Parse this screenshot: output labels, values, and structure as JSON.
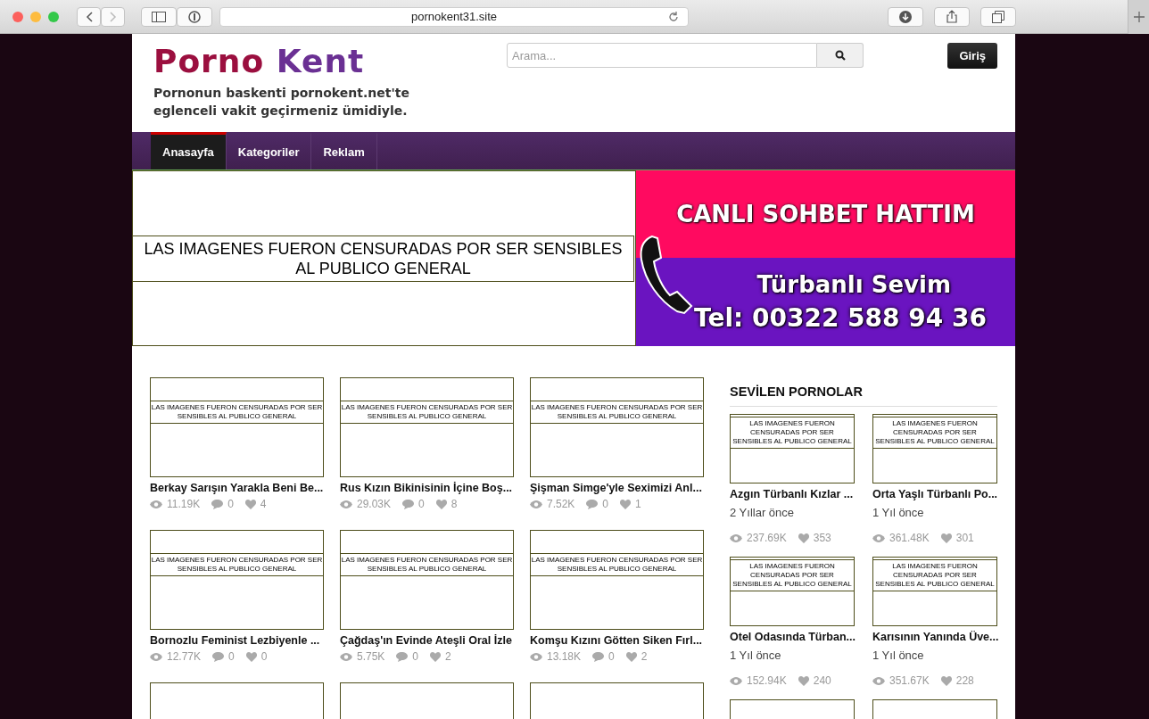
{
  "browser": {
    "url": "pornokent31.site"
  },
  "header": {
    "logo_first": "Porno",
    "logo_second": "Kent",
    "tagline_line1": "Pornonun baskenti pornokent.net'te",
    "tagline_line2": "eglenceli vakit geçirmeniz ümidiyle.",
    "search": {
      "placeholder": "Arama..."
    },
    "login": "Giriş"
  },
  "nav": [
    {
      "label": "Anasayfa",
      "selected": true
    },
    {
      "label": "Kategoriler",
      "selected": false
    },
    {
      "label": "Reklam",
      "selected": false
    }
  ],
  "banner": {
    "notice": "LAS IMAGENES FUERON CENSURADAS POR SER SENSIBLES AL PUBLICO GENERAL",
    "ad_title": "CANLI SOHBET HATTIM",
    "ad_name": "Türbanlı Sevim",
    "ad_phone": "Tel: 00322 588 94 36"
  },
  "videos": [
    {
      "notice": "LAS IMAGENES FUERON CENSURADAS POR SER SENSIBLES AL PUBLICO GENERAL",
      "title": "Berkay Sarışın Yarakla Beni Be...",
      "views": "11.19K",
      "comments": "0",
      "likes": "4"
    },
    {
      "notice": "LAS IMAGENES FUERON CENSURADAS POR SER SENSIBLES AL PUBLICO GENERAL",
      "title": "Rus Kızın Bikinisinin İçine Boş...",
      "views": "29.03K",
      "comments": "0",
      "likes": "8"
    },
    {
      "notice": "LAS IMAGENES FUERON CENSURADAS POR SER SENSIBLES AL PUBLICO GENERAL",
      "title": "Şişman Simge'yle Seximizi Anl...",
      "views": "7.52K",
      "comments": "0",
      "likes": "1"
    },
    {
      "notice": "LAS IMAGENES FUERON CENSURADAS POR SER SENSIBLES AL PUBLICO GENERAL",
      "title": "Bornozlu Feminist Lezbiyenle ...",
      "views": "12.77K",
      "comments": "0",
      "likes": "0"
    },
    {
      "notice": "LAS IMAGENES FUERON CENSURADAS POR SER SENSIBLES AL PUBLICO GENERAL",
      "title": "Çağdaş'ın Evinde Ateşli Oral İzle",
      "views": "5.75K",
      "comments": "0",
      "likes": "2"
    },
    {
      "notice": "LAS IMAGENES FUERON CENSURADAS POR SER SENSIBLES AL PUBLICO GENERAL",
      "title": "Komşu Kızını Götten Siken Fırl...",
      "views": "13.18K",
      "comments": "0",
      "likes": "2"
    },
    {
      "kind": "cut"
    },
    {
      "kind": "cut"
    },
    {
      "kind": "cut"
    }
  ],
  "sidebar": {
    "title": "SEVİLEN PORNOLAR",
    "items": [
      {
        "notice": "LAS IMAGENES FUERON CENSURADAS POR SER SENSIBLES AL PUBLICO GENERAL",
        "title": "Azgın Türbanlı Kızlar ...",
        "age": "2 Yıllar önce",
        "views": "237.69K",
        "likes": "353"
      },
      {
        "notice": "LAS IMAGENES FUERON CENSURADAS POR SER SENSIBLES AL PUBLICO GENERAL",
        "title": "Orta Yaşlı Türbanlı Po...",
        "age": "1 Yıl önce",
        "views": "361.48K",
        "likes": "301"
      },
      {
        "notice": "LAS IMAGENES FUERON CENSURADAS POR SER SENSIBLES AL PUBLICO GENERAL",
        "title": "Otel Odasında Türban...",
        "age": "1 Yıl önce",
        "views": "152.94K",
        "likes": "240"
      },
      {
        "notice": "LAS IMAGENES FUERON CENSURADAS POR SER SENSIBLES AL PUBLICO GENERAL",
        "title": "Karısının Yanında Üve...",
        "age": "1 Yıl önce",
        "views": "351.67K",
        "likes": "228"
      },
      {
        "kind": "cut"
      },
      {
        "kind": "cut"
      }
    ]
  }
}
